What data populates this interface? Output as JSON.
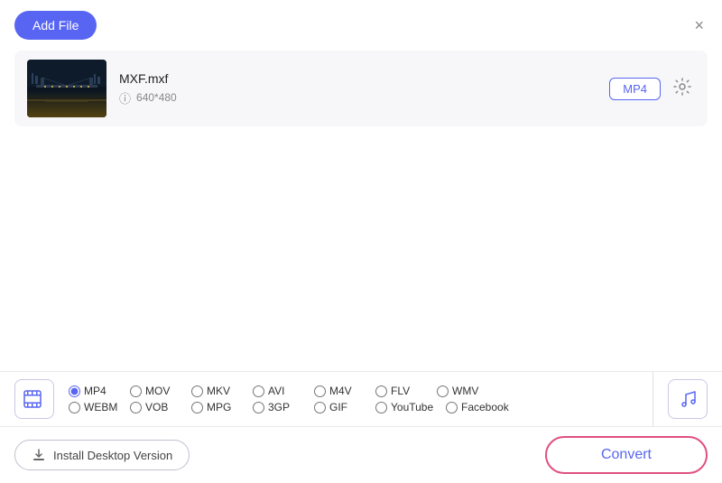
{
  "header": {
    "add_file_label": "Add File",
    "close_icon": "×"
  },
  "file": {
    "name": "MXF.mxf",
    "resolution": "640*480",
    "format": "MP4"
  },
  "formats": {
    "row1": [
      {
        "id": "mp4",
        "label": "MP4",
        "checked": true
      },
      {
        "id": "mov",
        "label": "MOV",
        "checked": false
      },
      {
        "id": "mkv",
        "label": "MKV",
        "checked": false
      },
      {
        "id": "avi",
        "label": "AVI",
        "checked": false
      },
      {
        "id": "m4v",
        "label": "M4V",
        "checked": false
      },
      {
        "id": "flv",
        "label": "FLV",
        "checked": false
      },
      {
        "id": "wmv",
        "label": "WMV",
        "checked": false
      }
    ],
    "row2": [
      {
        "id": "webm",
        "label": "WEBM",
        "checked": false
      },
      {
        "id": "vob",
        "label": "VOB",
        "checked": false
      },
      {
        "id": "mpg",
        "label": "MPG",
        "checked": false
      },
      {
        "id": "3gp",
        "label": "3GP",
        "checked": false
      },
      {
        "id": "gif",
        "label": "GIF",
        "checked": false
      },
      {
        "id": "youtube",
        "label": "YouTube",
        "checked": false
      },
      {
        "id": "facebook",
        "label": "Facebook",
        "checked": false
      }
    ]
  },
  "actions": {
    "install_label": "Install Desktop Version",
    "convert_label": "Convert"
  }
}
